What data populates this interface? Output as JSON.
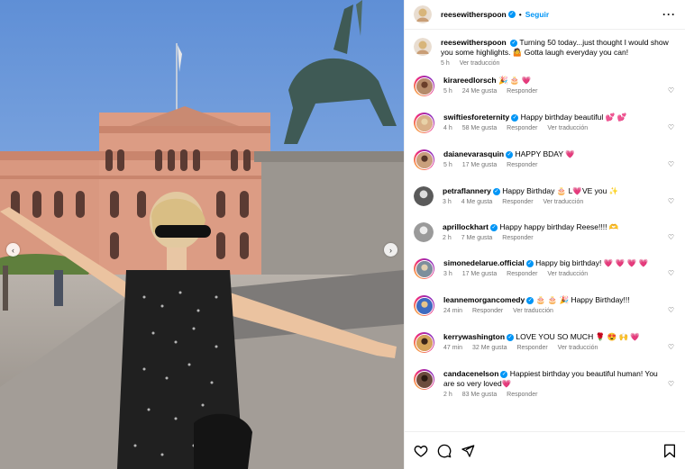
{
  "post": {
    "carousel": {
      "prev_icon": "chevron-left-icon",
      "next_icon": "chevron-right-icon"
    },
    "header": {
      "username": "reesewitherspoon",
      "separator": "•",
      "follow_label": "Seguir",
      "more_icon": "more-icon"
    },
    "caption": {
      "username": "reesewitherspoon",
      "text": "Turning 50 today...just thought I would show you some highlights. 🤷 Gotta laugh everyday you can!",
      "time": "5 h",
      "translate_label": "Ver traducción"
    },
    "comments": [
      {
        "username": "kirareedlorsch",
        "text": "🎉 🎂 💗",
        "time": "5 h",
        "likes": "24 Me gusta",
        "reply": "Responder",
        "translate": "",
        "verified": false
      },
      {
        "username": "swiftiesforeternity",
        "text": "Happy birthday beautiful 💕 💕",
        "time": "4 h",
        "likes": "58 Me gusta",
        "reply": "Responder",
        "translate": "Ver traducción",
        "verified": true
      },
      {
        "username": "daianevarasquin",
        "text": "HAPPY BDAY 💗",
        "time": "5 h",
        "likes": "17 Me gusta",
        "reply": "Responder",
        "translate": "",
        "verified": true
      },
      {
        "username": "petraflannery",
        "text": "Happy Birthday 🎂 L💗VE you ✨",
        "time": "3 h",
        "likes": "4 Me gusta",
        "reply": "Responder",
        "translate": "Ver traducción",
        "verified": true
      },
      {
        "username": "aprillockhart",
        "text": "Happy happy birthday Reese!!!! 🫶",
        "time": "2 h",
        "likes": "7 Me gusta",
        "reply": "Responder",
        "translate": "",
        "verified": true
      },
      {
        "username": "simonedelarue.official",
        "text": "Happy big birthday! 💗 💗 💗 💗",
        "time": "3 h",
        "likes": "17 Me gusta",
        "reply": "Responder",
        "translate": "Ver traducción",
        "verified": true
      },
      {
        "username": "leannemorgancomedy",
        "text": "🎂 🎂 🎉  Happy Birthday!!!",
        "time": "24 min",
        "likes": "",
        "reply": "Responder",
        "translate": "Ver traducción",
        "verified": true
      },
      {
        "username": "kerrywashington",
        "text": "LOVE YOU SO MUCH 🌹 😍 🙌 💗",
        "time": "47 min",
        "likes": "32 Me gusta",
        "reply": "Responder",
        "translate": "Ver traducción",
        "verified": true
      },
      {
        "username": "candacenelson",
        "text": "Happiest birthday you beautiful human! You are so very loved💗",
        "time": "2 h",
        "likes": "83 Me gusta",
        "reply": "Responder",
        "translate": "",
        "verified": true
      }
    ],
    "actions": {
      "like_icon": "heart-icon",
      "comment_icon": "comment-icon",
      "share_icon": "share-icon",
      "save_icon": "bookmark-icon"
    }
  }
}
